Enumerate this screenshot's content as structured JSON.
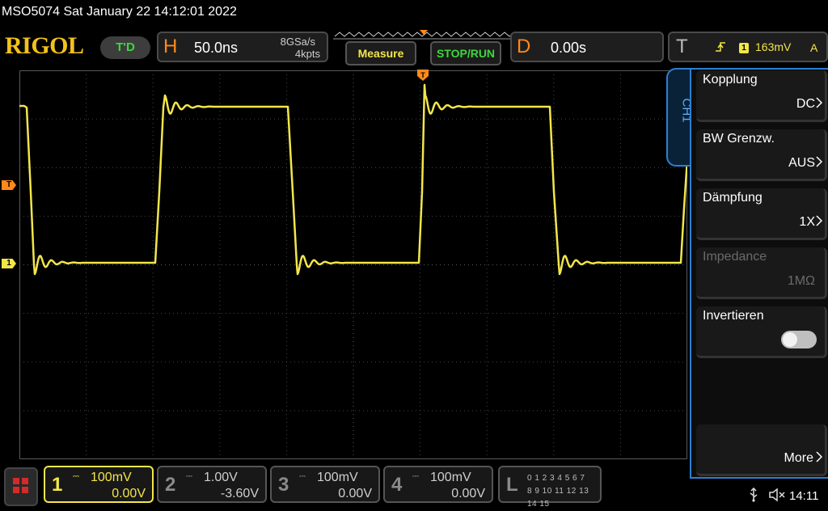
{
  "title": "MSO5074  Sat January 22 14:12:01 2022",
  "brand": "RIGOL",
  "run_state": "T'D",
  "horizontal": {
    "letter": "H",
    "timebase": "50.0ns",
    "sample_rate": "8GSa/s",
    "memory_depth": "4kpts"
  },
  "buttons": {
    "measure": "Measure",
    "stop_run": "STOP/RUN"
  },
  "delay": {
    "letter": "D",
    "value": "0.00s"
  },
  "trigger": {
    "letter": "T",
    "edge_icon": "rising-edge-icon",
    "source": "1",
    "level": "163mV",
    "mode": "A"
  },
  "markers": {
    "trigger": "T",
    "ch1": "1",
    "trigger_position": "T"
  },
  "menu": {
    "tab": "CH1",
    "items": [
      {
        "label": "Kopplung",
        "value": "DC",
        "disabled": false
      },
      {
        "label": "BW Grenzw.",
        "value": "AUS",
        "disabled": false
      },
      {
        "label": "Dämpfung",
        "value": "1X",
        "disabled": false
      },
      {
        "label": "Impedance",
        "value": "1MΩ",
        "disabled": true
      },
      {
        "label": "Invertieren",
        "value": "",
        "toggle": false
      },
      {
        "label": "",
        "value": "",
        "blank": true
      },
      {
        "label": "More",
        "value": "",
        "more": true
      }
    ],
    "more": "More"
  },
  "channels": [
    {
      "num": "1",
      "scale": "100mV",
      "offset": "0.00V",
      "active": true,
      "color": "#f2e64a"
    },
    {
      "num": "2",
      "scale": "1.00V",
      "offset": "-3.60V",
      "active": false
    },
    {
      "num": "3",
      "scale": "100mV",
      "offset": "0.00V",
      "active": false
    },
    {
      "num": "4",
      "scale": "100mV",
      "offset": "0.00V",
      "active": false
    }
  ],
  "logic": {
    "letter": "L",
    "row1": "0 1 2 3  4 5 6 7",
    "row2": "8 9 10 11 12 13 14 15"
  },
  "status": {
    "time": "14:11",
    "usb_icon": "usb-icon",
    "speaker_icon": "speaker-muted-icon"
  },
  "colors": {
    "ch1": "#f2e64a",
    "orange": "#ff8a1a",
    "menu_border": "#2d7fd2",
    "stop_run": "#3bd93b"
  }
}
